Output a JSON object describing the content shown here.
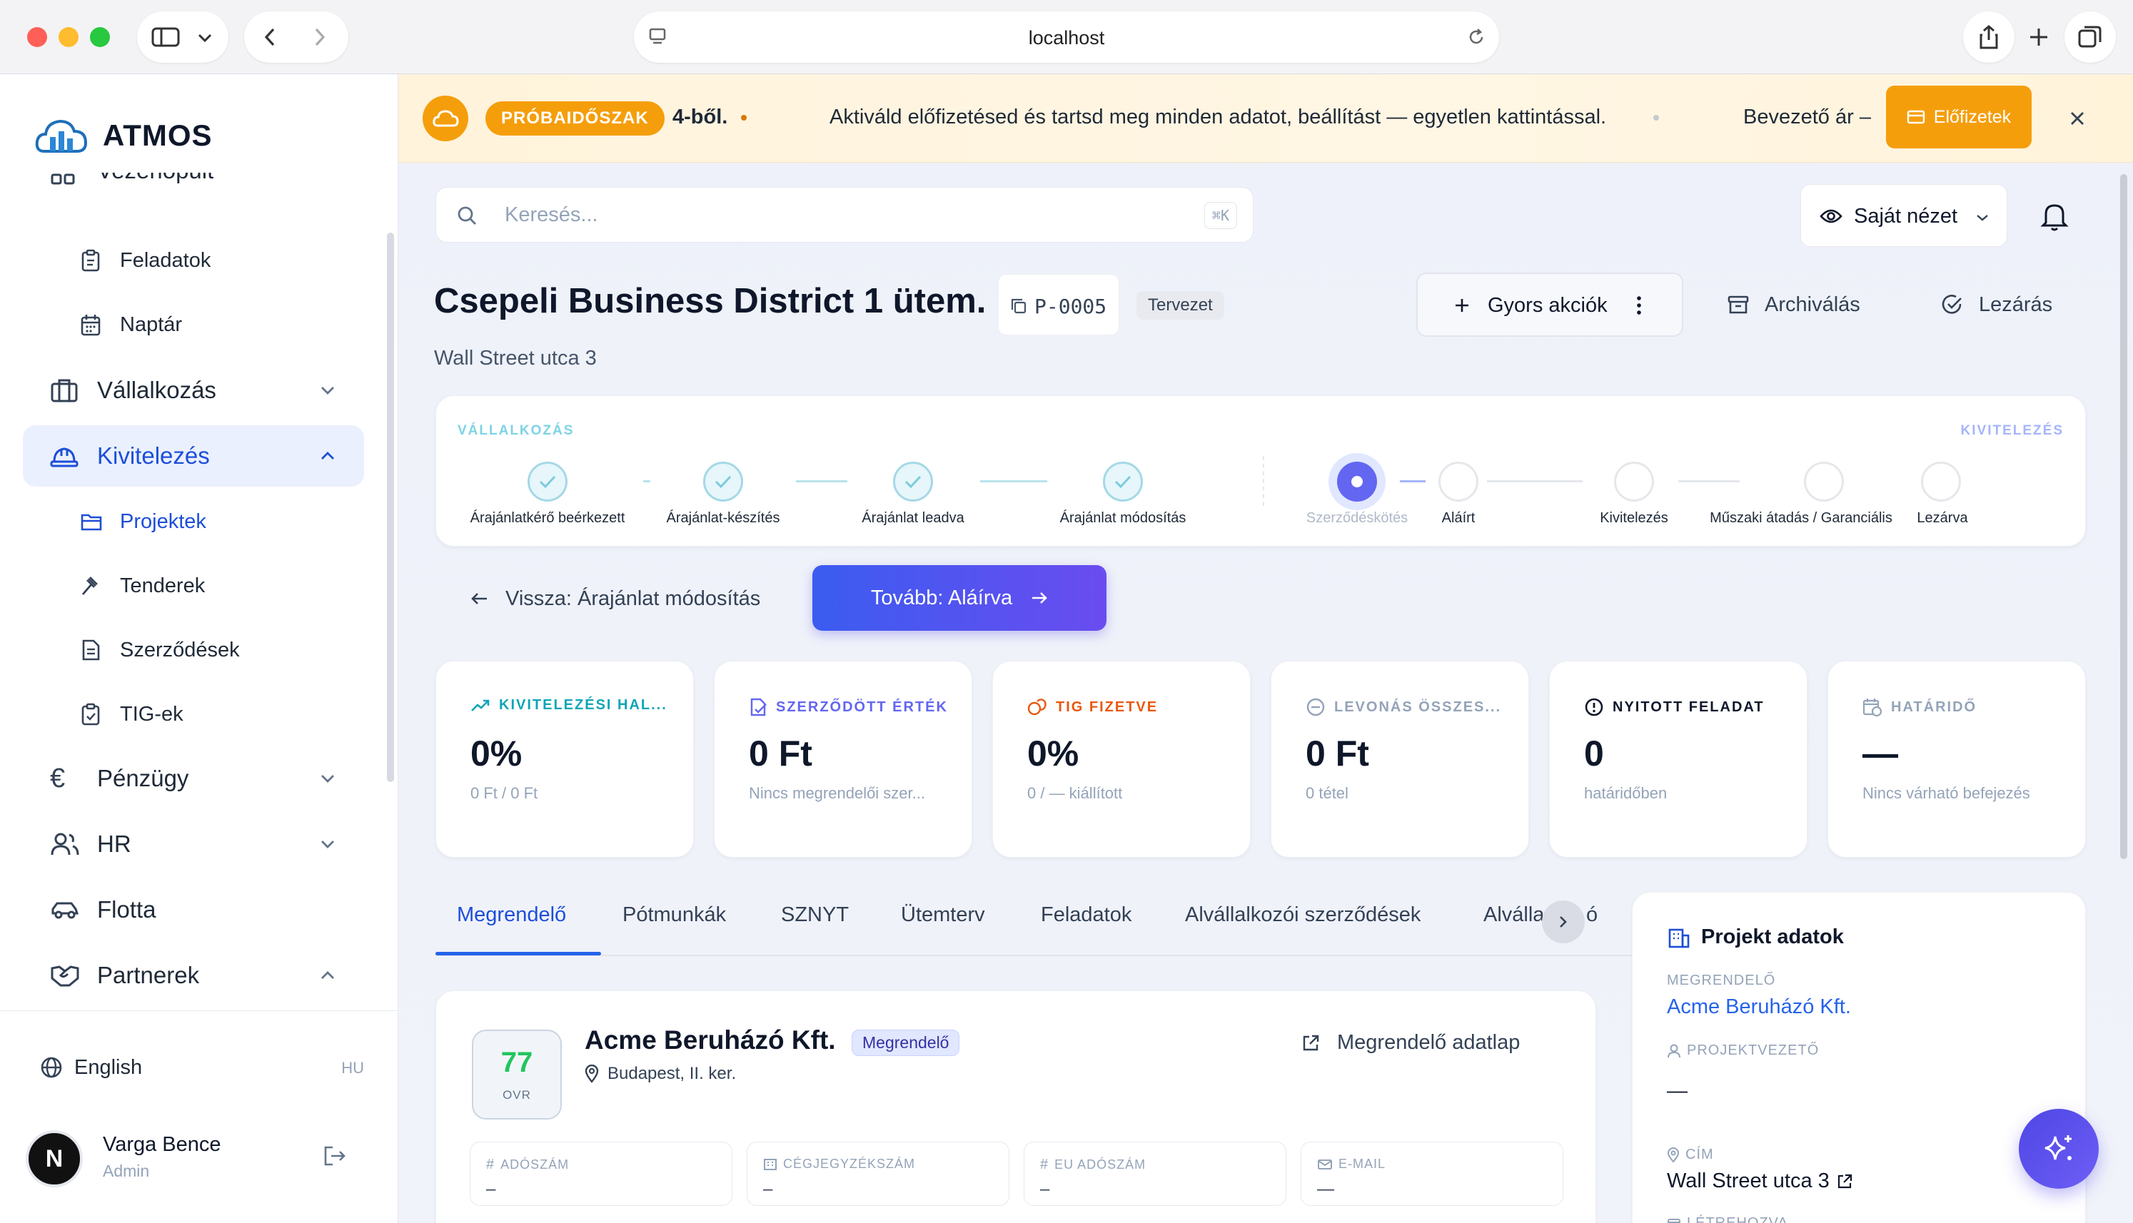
{
  "browser": {
    "url": "localhost"
  },
  "sidebar": {
    "brand": "ATMOS",
    "partial_top": "Vezérlőpult",
    "items": [
      {
        "label": "Feladatok",
        "type": "sub"
      },
      {
        "label": "Naptár",
        "type": "sub"
      },
      {
        "label": "Vállalkozás",
        "type": "group"
      },
      {
        "label": "Kivitelezés",
        "type": "group",
        "active": true
      },
      {
        "label": "Projektek",
        "type": "sub",
        "active": true
      },
      {
        "label": "Tenderek",
        "type": "sub"
      },
      {
        "label": "Szerződések",
        "type": "sub"
      },
      {
        "label": "TIG-ek",
        "type": "sub"
      },
      {
        "label": "Pénzügy",
        "type": "group"
      },
      {
        "label": "HR",
        "type": "group"
      },
      {
        "label": "Flotta",
        "type": "group"
      },
      {
        "label": "Partnerek",
        "type": "group"
      }
    ],
    "language": "English",
    "language_code": "HU",
    "user": {
      "name": "Varga Bence",
      "role": "Admin",
      "initial": "N"
    }
  },
  "banner": {
    "badge": "PRÓBAIDŐSZAK",
    "count": "4-ből.",
    "message": "Aktiváld előfizetésed és tartsd meg minden adatot, beállítást — egyetlen kattintással.",
    "price_label": "Bevezető ár –",
    "cta": "Előfizetek"
  },
  "topbar": {
    "search_placeholder": "Keresés...",
    "shortcut": "⌘K",
    "view": "Saját nézet"
  },
  "project": {
    "title": "Csepeli Business District 1 ütem.",
    "code": "P-0005",
    "status": "Tervezet",
    "address": "Wall Street utca 3",
    "actions": {
      "quick": "Gyors akciók",
      "archive": "Archiválás",
      "close": "Lezárás"
    }
  },
  "pipeline": {
    "left_title": "VÁLLALKOZÁS",
    "right_title": "KIVITELEZÉS",
    "steps": [
      {
        "label": "Árajánlatkérő beérkezett",
        "state": "done"
      },
      {
        "label": "Árajánlat-készítés",
        "state": "done"
      },
      {
        "label": "Árajánlat leadva",
        "state": "done"
      },
      {
        "label": "Árajánlat módosítás",
        "state": "done"
      },
      {
        "label": "Szerződéskötés",
        "state": "current"
      },
      {
        "label": "Aláírt",
        "state": "todo"
      },
      {
        "label": "Kivitelezés",
        "state": "todo"
      },
      {
        "label": "Műszaki átadás / Garanciális",
        "state": "todo"
      },
      {
        "label": "Lezárva",
        "state": "todo"
      }
    ],
    "back": "Vissza: Árajánlat módosítás",
    "next": "Tovább: Aláírva"
  },
  "kpis": [
    {
      "label": "KIVITELEZÉSI HAL...",
      "value": "0%",
      "sub": "0 Ft / 0 Ft",
      "color": "#0ea5b7",
      "icon": "trend-up-icon"
    },
    {
      "label": "SZERZŐDÖTT ÉRTÉK",
      "value": "0 Ft",
      "sub": "Nincs megrendelői szer...",
      "color": "#6366f1",
      "icon": "contract-icon"
    },
    {
      "label": "TIG FIZETVE",
      "value": "0%",
      "sub": "0 / — kiállított",
      "color": "#ea580c",
      "icon": "coins-icon"
    },
    {
      "label": "LEVONÁS ÖSSZES...",
      "value": "0 Ft",
      "sub": "0 tétel",
      "color": "#94a3b8",
      "icon": "minus-circle-icon"
    },
    {
      "label": "NYITOTT FELADAT",
      "value": "0",
      "sub": "határidőben",
      "color": "#0f172a",
      "icon": "alert-circle-icon"
    },
    {
      "label": "HATÁRIDŐ",
      "value": "—",
      "sub": "Nincs várható befejezés",
      "color": "#94a3b8",
      "icon": "calendar-clock-icon"
    }
  ],
  "tabs": [
    "Megrendelő",
    "Pótmunkák",
    "SZNYT",
    "Ütemterv",
    "Feladatok",
    "Alvállalkozói szerződések",
    "Alválla",
    "ó"
  ],
  "customer": {
    "score": "77",
    "score_label": "OVR",
    "name": "Acme Beruházó Kft.",
    "role": "Megrendelő",
    "location": "Budapest, II. ker.",
    "link": "Megrendelő adatlap",
    "fields": [
      {
        "label": "ADÓSZÁM",
        "value": "–"
      },
      {
        "label": "CÉGJEGYZÉKSZÁM",
        "value": "–"
      },
      {
        "label": "EU ADÓSZÁM",
        "value": "–"
      },
      {
        "label": "E-MAIL",
        "value": "—"
      }
    ]
  },
  "project_data": {
    "title": "Projekt adatok",
    "customer_label": "MEGRENDELŐ",
    "customer_value": "Acme Beruházó Kft.",
    "manager_label": "PROJEKTVEZETŐ",
    "manager_value": "—",
    "address_label": "CÍM",
    "address_value": "Wall Street utca 3",
    "created_label": "LÉTREHOZVA"
  }
}
